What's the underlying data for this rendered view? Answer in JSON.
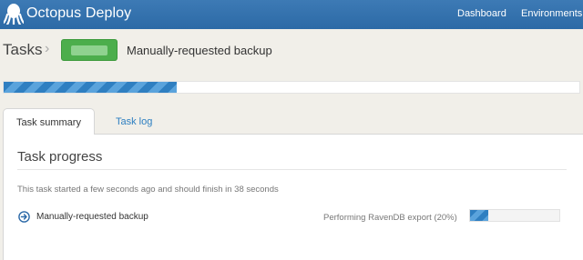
{
  "app": {
    "title": "Octopus Deploy",
    "logo_icon": "octopus-icon"
  },
  "nav": {
    "items": [
      {
        "label": "Dashboard"
      },
      {
        "label": "Environments"
      }
    ]
  },
  "breadcrumb": {
    "root": "Tasks",
    "separator": "›"
  },
  "task": {
    "title": "Manually-requested backup",
    "status_color": "#4cae4c",
    "overall_progress": 0.3
  },
  "tabs": [
    {
      "label": "Task summary",
      "active": true
    },
    {
      "label": "Task log",
      "active": false
    }
  ],
  "summary": {
    "heading": "Task progress",
    "message": "This task started a few seconds ago and should finish in 38 seconds",
    "steps": [
      {
        "name": "Manually-requested backup",
        "status": "Performing RavenDB export (20%)",
        "progress": 0.2,
        "icon": "circle-arrow-right-icon"
      }
    ]
  },
  "colors": {
    "topbar": "#2c6aa6",
    "accent": "#2d7fc1",
    "success": "#4cae4c"
  }
}
